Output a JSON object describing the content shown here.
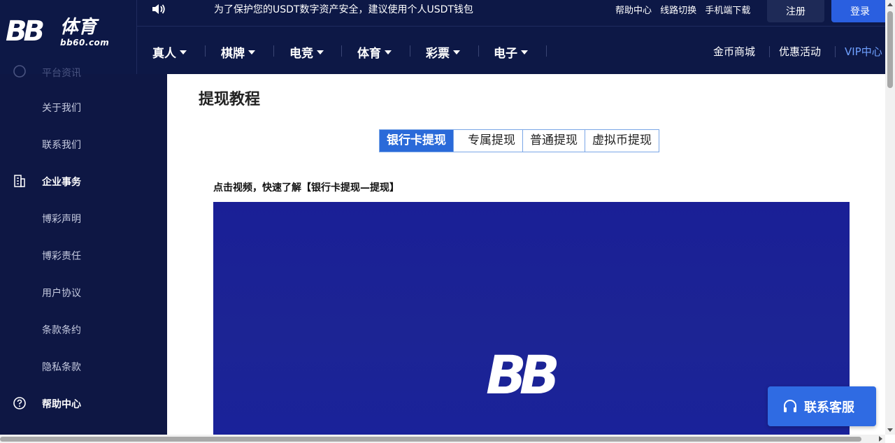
{
  "header": {
    "logo": {
      "mark": "BB",
      "name": "体育",
      "domain": "bb60.com"
    },
    "notice": "为了保护您的USDT数字资产安全，建议使用个人USDT钱包",
    "top_links": [
      "帮助中心",
      "线路切换",
      "手机端下载"
    ],
    "register_label": "注册",
    "login_label": "登录",
    "nav": [
      {
        "label": "真人"
      },
      {
        "label": "棋牌"
      },
      {
        "label": "电竞"
      },
      {
        "label": "体育"
      },
      {
        "label": "彩票"
      },
      {
        "label": "电子"
      }
    ],
    "nav_right": [
      "金币商城",
      "优惠活动",
      "VIP中心"
    ]
  },
  "sidebar": {
    "partial_top_label": "平台资讯",
    "items": [
      {
        "label": "关于我们",
        "group": false
      },
      {
        "label": "联系我们",
        "group": false
      },
      {
        "label": "企业事务",
        "group": true,
        "icon": "building-icon"
      },
      {
        "label": "博彩声明",
        "group": false
      },
      {
        "label": "博彩责任",
        "group": false
      },
      {
        "label": "用户协议",
        "group": false
      },
      {
        "label": "条款条约",
        "group": false
      },
      {
        "label": "隐私条款",
        "group": false
      },
      {
        "label": "帮助中心",
        "group": true,
        "icon": "question-circle-icon"
      }
    ]
  },
  "main": {
    "title": "提现教程",
    "tabs": [
      {
        "label": "银行卡提现",
        "active": true
      },
      {
        "label": "专属提现",
        "active": false
      },
      {
        "label": "普通提现",
        "active": false
      },
      {
        "label": "虚拟币提现",
        "active": false
      }
    ],
    "video_caption": "点击视频，快速了解【银行卡提现—提现】",
    "video_logo": "BB"
  },
  "service": {
    "label": "联系客服",
    "icon": "headset-icon"
  },
  "colors": {
    "header_bg": "#0d1846",
    "sidebar_bg": "#0e1744",
    "accent_blue": "#2a6ad9",
    "login_blue": "#2a5fe0",
    "video_bg": "#1a1f96",
    "vip_text": "#6fa0ff"
  }
}
